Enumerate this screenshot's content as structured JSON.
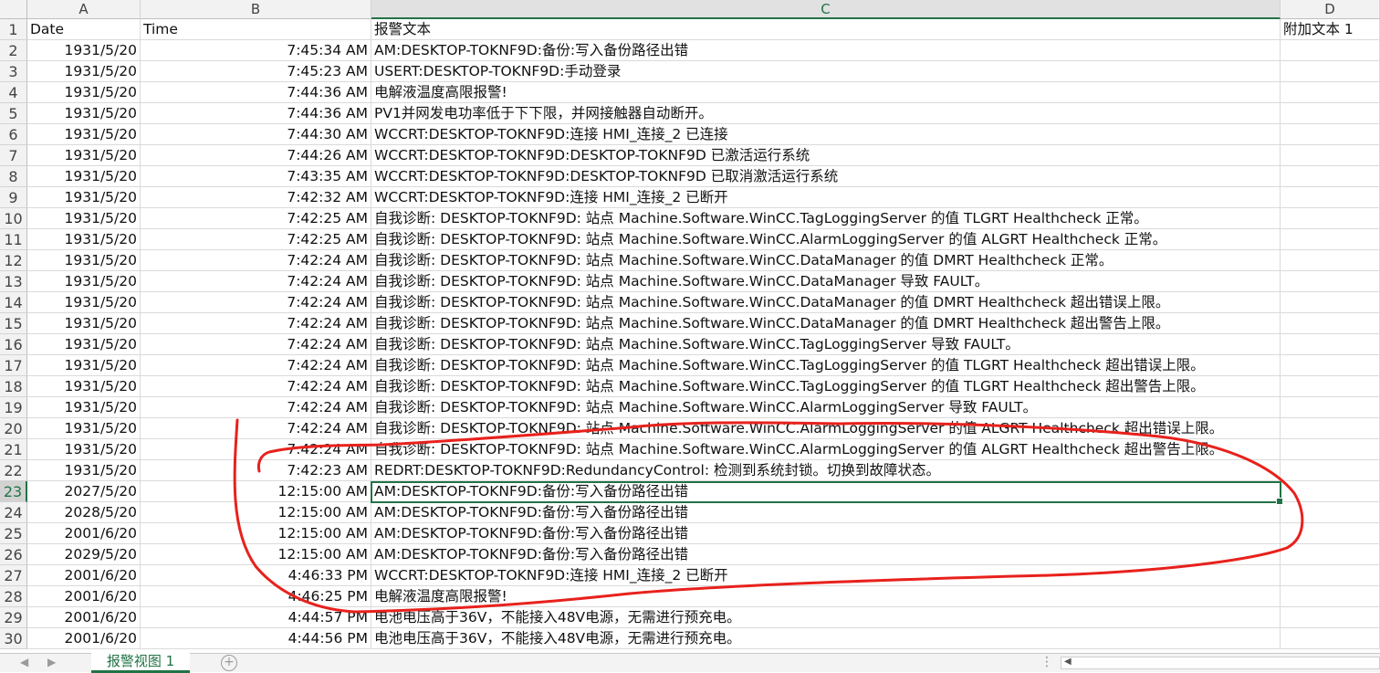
{
  "columns": [
    "A",
    "B",
    "C",
    "D"
  ],
  "header_row": {
    "date": "Date",
    "time": "Time",
    "text": "报警文本",
    "extra": "附加文本 1"
  },
  "rows": [
    {
      "n": "2",
      "date": "1931/5/20",
      "time": "7:45:34 AM",
      "text": "AM:DESKTOP-TOKNF9D:备份:写入备份路径出错"
    },
    {
      "n": "3",
      "date": "1931/5/20",
      "time": "7:45:23 AM",
      "text": "USERT:DESKTOP-TOKNF9D:手动登录"
    },
    {
      "n": "4",
      "date": "1931/5/20",
      "time": "7:44:36 AM",
      "text": "电解液温度高限报警!"
    },
    {
      "n": "5",
      "date": "1931/5/20",
      "time": "7:44:36 AM",
      "text": "PV1并网发电功率低于下下限，并网接触器自动断开。"
    },
    {
      "n": "6",
      "date": "1931/5/20",
      "time": "7:44:30 AM",
      "text": "WCCRT:DESKTOP-TOKNF9D:连接 HMI_连接_2 已连接"
    },
    {
      "n": "7",
      "date": "1931/5/20",
      "time": "7:44:26 AM",
      "text": "WCCRT:DESKTOP-TOKNF9D:DESKTOP-TOKNF9D 已激活运行系统"
    },
    {
      "n": "8",
      "date": "1931/5/20",
      "time": "7:43:35 AM",
      "text": "WCCRT:DESKTOP-TOKNF9D:DESKTOP-TOKNF9D 已取消激活运行系统"
    },
    {
      "n": "9",
      "date": "1931/5/20",
      "time": "7:42:32 AM",
      "text": "WCCRT:DESKTOP-TOKNF9D:连接 HMI_连接_2 已断开"
    },
    {
      "n": "10",
      "date": "1931/5/20",
      "time": "7:42:25 AM",
      "text": "自我诊断: DESKTOP-TOKNF9D: 站点 Machine.Software.WinCC.TagLoggingServer 的值 TLGRT Healthcheck 正常。"
    },
    {
      "n": "11",
      "date": "1931/5/20",
      "time": "7:42:25 AM",
      "text": "自我诊断: DESKTOP-TOKNF9D: 站点 Machine.Software.WinCC.AlarmLoggingServer 的值 ALGRT Healthcheck 正常。"
    },
    {
      "n": "12",
      "date": "1931/5/20",
      "time": "7:42:24 AM",
      "text": "自我诊断: DESKTOP-TOKNF9D: 站点 Machine.Software.WinCC.DataManager 的值 DMRT Healthcheck 正常。"
    },
    {
      "n": "13",
      "date": "1931/5/20",
      "time": "7:42:24 AM",
      "text": "自我诊断: DESKTOP-TOKNF9D: 站点 Machine.Software.WinCC.DataManager 导致 FAULT。"
    },
    {
      "n": "14",
      "date": "1931/5/20",
      "time": "7:42:24 AM",
      "text": "自我诊断: DESKTOP-TOKNF9D: 站点 Machine.Software.WinCC.DataManager 的值 DMRT Healthcheck 超出错误上限。"
    },
    {
      "n": "15",
      "date": "1931/5/20",
      "time": "7:42:24 AM",
      "text": "自我诊断: DESKTOP-TOKNF9D: 站点 Machine.Software.WinCC.DataManager 的值 DMRT Healthcheck 超出警告上限。"
    },
    {
      "n": "16",
      "date": "1931/5/20",
      "time": "7:42:24 AM",
      "text": "自我诊断: DESKTOP-TOKNF9D: 站点 Machine.Software.WinCC.TagLoggingServer 导致 FAULT。"
    },
    {
      "n": "17",
      "date": "1931/5/20",
      "time": "7:42:24 AM",
      "text": "自我诊断: DESKTOP-TOKNF9D: 站点 Machine.Software.WinCC.TagLoggingServer 的值 TLGRT Healthcheck 超出错误上限。"
    },
    {
      "n": "18",
      "date": "1931/5/20",
      "time": "7:42:24 AM",
      "text": "自我诊断: DESKTOP-TOKNF9D: 站点 Machine.Software.WinCC.TagLoggingServer 的值 TLGRT Healthcheck 超出警告上限。"
    },
    {
      "n": "19",
      "date": "1931/5/20",
      "time": "7:42:24 AM",
      "text": "自我诊断: DESKTOP-TOKNF9D: 站点 Machine.Software.WinCC.AlarmLoggingServer 导致 FAULT。"
    },
    {
      "n": "20",
      "date": "1931/5/20",
      "time": "7:42:24 AM",
      "text": "自我诊断: DESKTOP-TOKNF9D: 站点 Machine.Software.WinCC.AlarmLoggingServer 的值 ALGRT Healthcheck 超出错误上限。"
    },
    {
      "n": "21",
      "date": "1931/5/20",
      "time": "7:42:24 AM",
      "text": "自我诊断: DESKTOP-TOKNF9D: 站点 Machine.Software.WinCC.AlarmLoggingServer 的值 ALGRT Healthcheck 超出警告上限。"
    },
    {
      "n": "22",
      "date": "1931/5/20",
      "time": "7:42:23 AM",
      "text": "REDRT:DESKTOP-TOKNF9D:RedundancyControl:  检测到系统封锁。切换到故障状态。"
    },
    {
      "n": "23",
      "date": "2027/5/20",
      "time": "12:15:00 AM",
      "text": "AM:DESKTOP-TOKNF9D:备份:写入备份路径出错"
    },
    {
      "n": "24",
      "date": "2028/5/20",
      "time": "12:15:00 AM",
      "text": "AM:DESKTOP-TOKNF9D:备份:写入备份路径出错"
    },
    {
      "n": "25",
      "date": "2001/6/20",
      "time": "12:15:00 AM",
      "text": "AM:DESKTOP-TOKNF9D:备份:写入备份路径出错"
    },
    {
      "n": "26",
      "date": "2029/5/20",
      "time": "12:15:00 AM",
      "text": "AM:DESKTOP-TOKNF9D:备份:写入备份路径出错"
    },
    {
      "n": "27",
      "date": "2001/6/20",
      "time": "4:46:33 PM",
      "text": "WCCRT:DESKTOP-TOKNF9D:连接 HMI_连接_2 已断开"
    },
    {
      "n": "28",
      "date": "2001/6/20",
      "time": "4:46:25 PM",
      "text": "电解液温度高限报警!"
    },
    {
      "n": "29",
      "date": "2001/6/20",
      "time": "4:44:57 PM",
      "text": "电池电压高于36V，不能接入48V电源，无需进行预充电。"
    },
    {
      "n": "30",
      "date": "2001/6/20",
      "time": "4:44:56 PM",
      "text": "电池电压高于36V，不能接入48V电源，无需进行预充电。"
    }
  ],
  "selected_row": "23",
  "selected_column": "C",
  "sheet_tab": "报警视图 1",
  "annotation_color": "#e8211c",
  "accent_color": "#217346"
}
